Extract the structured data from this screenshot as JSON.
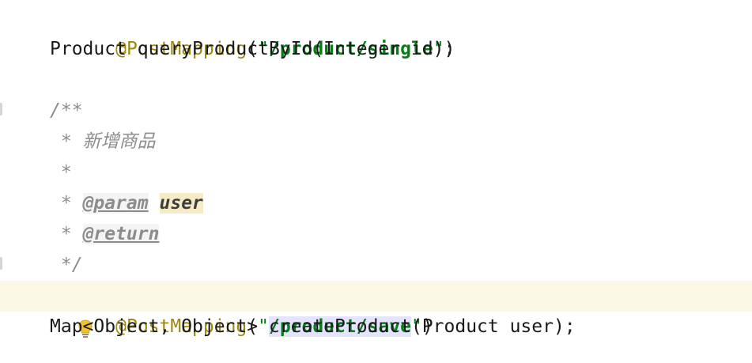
{
  "editor": {
    "lines": {
      "l1": {
        "annotation": "@PostMapping",
        "open": "(",
        "quote_open": "\"",
        "string": "/product/single",
        "quote_close": "\"",
        "close": ")"
      },
      "l2": {
        "text": "Product queryProductById(Integer id);"
      },
      "l4": {
        "text": "/**"
      },
      "l5": {
        "prefix": " * ",
        "text": "新增商品"
      },
      "l6": {
        "text": " *"
      },
      "l7": {
        "prefix": " * ",
        "tag": "@param",
        "space": " ",
        "param": "user"
      },
      "l8": {
        "prefix": " * ",
        "tag": "@return"
      },
      "l9": {
        "text": " */"
      },
      "l10": {
        "annotation": "@PostMapping",
        "open": "(",
        "quote_open": "\"",
        "string": "/product/save",
        "quote_close": "\"",
        "close": ")"
      },
      "l11": {
        "text": "Map<Object, Object> createProduct(Product user);"
      }
    },
    "gutter_icon": "lightbulb-icon",
    "colors": {
      "annotation": "#9e880d",
      "string": "#067d17",
      "comment": "#8c8c8c",
      "current_line": "#fcf8e6",
      "selection": "#e4e4ff",
      "param_highlight": "#f5ebc7",
      "bulb": "#f2c12e"
    }
  }
}
